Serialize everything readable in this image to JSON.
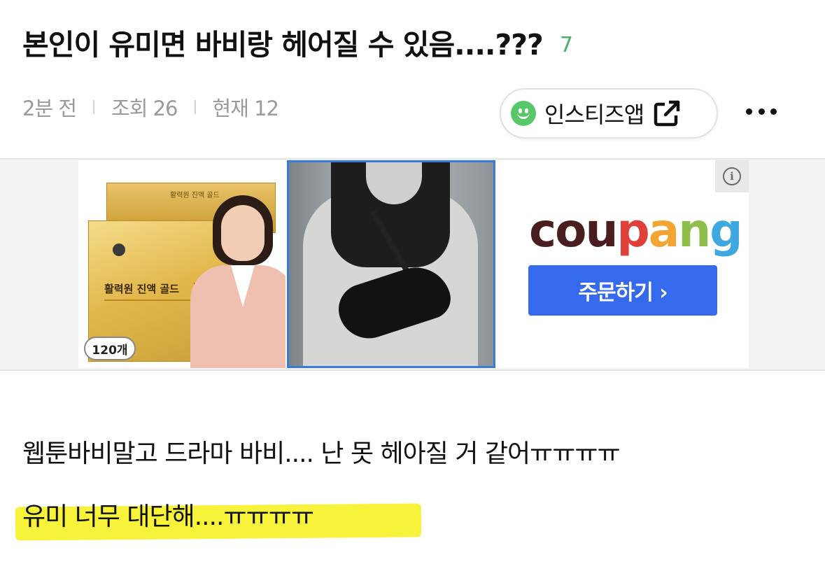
{
  "post": {
    "title": "본인이 유미면 바비랑 헤어질 수 있음....???",
    "comment_count": "7",
    "meta": {
      "time": "2분 전",
      "views": "조회 26",
      "current": "현재 12"
    },
    "app_button": {
      "label": "인스티즈앱"
    },
    "body_lines": [
      "웹툰바비말고 드라마 바비.... 난 못 헤아질 거 같어ㅠㅠㅠㅠ",
      "유미 너무 대단해....ㅠㅠㅠㅠ"
    ]
  },
  "ad": {
    "product1": {
      "box_label": "활력원 진액 골드",
      "count": "120개"
    },
    "brand": "coupang",
    "cta_label": "주문하기 ›",
    "colors": {
      "c": "#4a1e1e",
      "o": "#4a1e1e",
      "u": "#4a1e1e",
      "p": "#e0403a",
      "a": "#f3a533",
      "n": "#8fbe4a",
      "g": "#3fa8e0",
      "button": "#346aeb"
    },
    "info_icon": "info-icon"
  },
  "icons": [
    "smiley-icon",
    "external-link-icon",
    "more-icon"
  ],
  "colors": {
    "comment_count": "#4caf6a",
    "highlight": "#f7f23a"
  }
}
